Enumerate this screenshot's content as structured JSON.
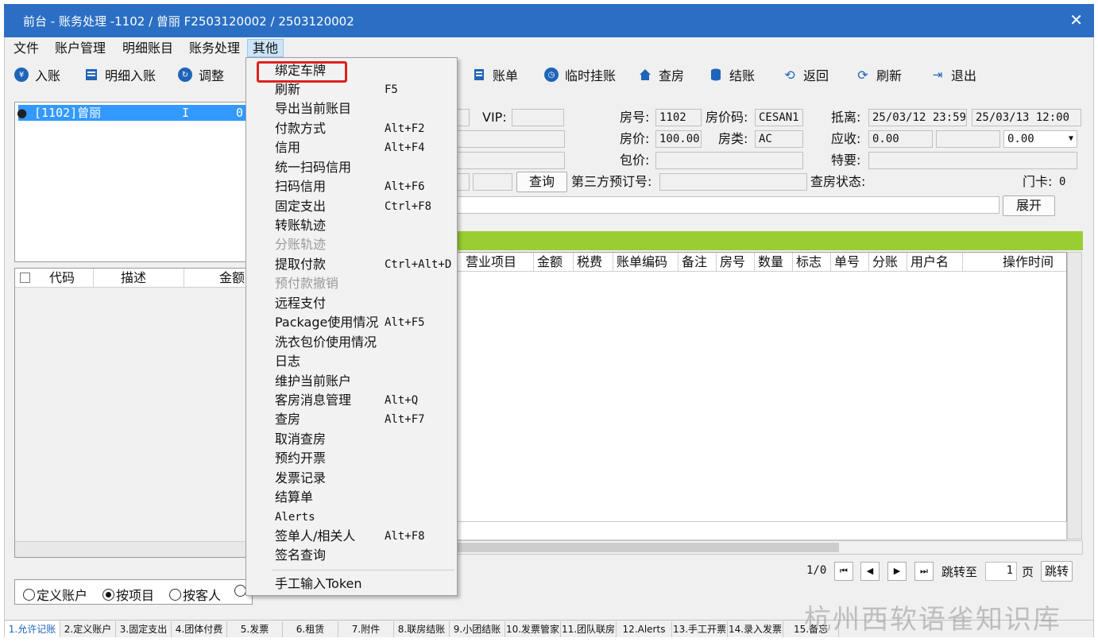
{
  "window": {
    "title": "前台 - 账务处理 -1102 / 曾丽  F2503120002 / 2503120002",
    "close_glyph": "✕"
  },
  "menubar": [
    "文件",
    "账户管理",
    "明细账目",
    "账务处理",
    "其他"
  ],
  "toolbar": {
    "entry": "入账",
    "detail_entry": "明细入账",
    "adjust": "调整",
    "bill": "账单",
    "temp_hold": "临时挂账",
    "check_room": "查房",
    "checkout": "结账",
    "back": "返回",
    "refresh": "刷新",
    "exit": "退出"
  },
  "accounts": {
    "row": "[1102]曾丽",
    "flag": "I",
    "amount": "0."
  },
  "account_table": {
    "headers": [
      "代码",
      "描述",
      "金额"
    ]
  },
  "form": {
    "vip_label": "VIP:",
    "room_no_label": "房号:",
    "room_no": "1102",
    "rate_code_label": "房价码:",
    "rate_code": "CESAN1",
    "arr_dep_label": "抵离:",
    "arrival": "25/03/12 23:59",
    "departure": "25/03/13 12:00",
    "rate_label": "房价:",
    "rate": "100.00",
    "room_type_label": "房类:",
    "room_type": "AC",
    "receivable_label": "应收:",
    "receivable": "0.00",
    "receivable_select": "0.00",
    "package_label": "包价:",
    "special_label": "特要:",
    "query_btn": "查询",
    "third_party_label": "第三方预订号:",
    "checkroom_status_label": "查房状态:",
    "door_card_label": "门卡:",
    "door_card": "0",
    "expand_btn": "展开"
  },
  "ledger": {
    "headers": [
      "营业项目",
      "金额",
      "税费",
      "账单编码",
      "备注",
      "房号",
      "数量",
      "标志",
      "单号",
      "分账",
      "用户名",
      "操作时间"
    ],
    "pager": {
      "count": "1/0",
      "jump_label": "跳转至",
      "page_value": "1",
      "page_label": "页",
      "jump_btn": "跳转"
    }
  },
  "radios": [
    {
      "label": "定义账户",
      "checked": false
    },
    {
      "label": "按项目",
      "checked": true
    },
    {
      "label": "按客人",
      "checked": false
    }
  ],
  "dropdown": [
    {
      "label": "绑定车牌",
      "shortcut": ""
    },
    {
      "label": "刷新",
      "shortcut": "F5"
    },
    {
      "label": "导出当前账目",
      "shortcut": ""
    },
    {
      "label": "付款方式",
      "shortcut": "Alt+F2"
    },
    {
      "label": "信用",
      "shortcut": "Alt+F4"
    },
    {
      "label": "统一扫码信用",
      "shortcut": ""
    },
    {
      "label": "扫码信用",
      "shortcut": "Alt+F6"
    },
    {
      "label": "固定支出",
      "shortcut": "Ctrl+F8"
    },
    {
      "label": "转账轨迹",
      "shortcut": ""
    },
    {
      "label": "分账轨迹",
      "shortcut": "",
      "disabled": true
    },
    {
      "label": "提取付款",
      "shortcut": "Ctrl+Alt+D"
    },
    {
      "label": "预付款撤销",
      "shortcut": "",
      "disabled": true
    },
    {
      "label": "远程支付",
      "shortcut": ""
    },
    {
      "label": "Package使用情况",
      "shortcut": "Alt+F5"
    },
    {
      "label": "洗衣包价使用情况",
      "shortcut": ""
    },
    {
      "label": "日志",
      "shortcut": ""
    },
    {
      "label": "维护当前账户",
      "shortcut": ""
    },
    {
      "label": "客房消息管理",
      "shortcut": "Alt+Q"
    },
    {
      "label": "查房",
      "shortcut": "Alt+F7"
    },
    {
      "label": "取消查房",
      "shortcut": ""
    },
    {
      "label": "预约开票",
      "shortcut": ""
    },
    {
      "label": "发票记录",
      "shortcut": ""
    },
    {
      "label": "结算单",
      "shortcut": ""
    },
    {
      "label": "Alerts",
      "shortcut": ""
    },
    {
      "label": "签单人/相关人",
      "shortcut": "Alt+F8"
    },
    {
      "label": "签名查询",
      "shortcut": ""
    },
    {
      "label": "手工输入Token",
      "shortcut": ""
    }
  ],
  "tabs": [
    "1.允许记账",
    "2.定义账户",
    "3.固定支出",
    "4.团体付费",
    "5.发票",
    "6.租赁",
    "7.附件",
    "8.联房结账",
    "9.小团结账",
    "10.发票管家",
    "11.团队联房",
    "12.Alerts",
    "13.手工开票",
    "14.录入发票",
    "15.备忘"
  ],
  "watermark": "杭州西软语雀知识库",
  "colors": {
    "title_bar": "#2b6fc4",
    "selection": "#3399ff",
    "green_bar": "#9acd32",
    "highlight": "#e02020"
  }
}
